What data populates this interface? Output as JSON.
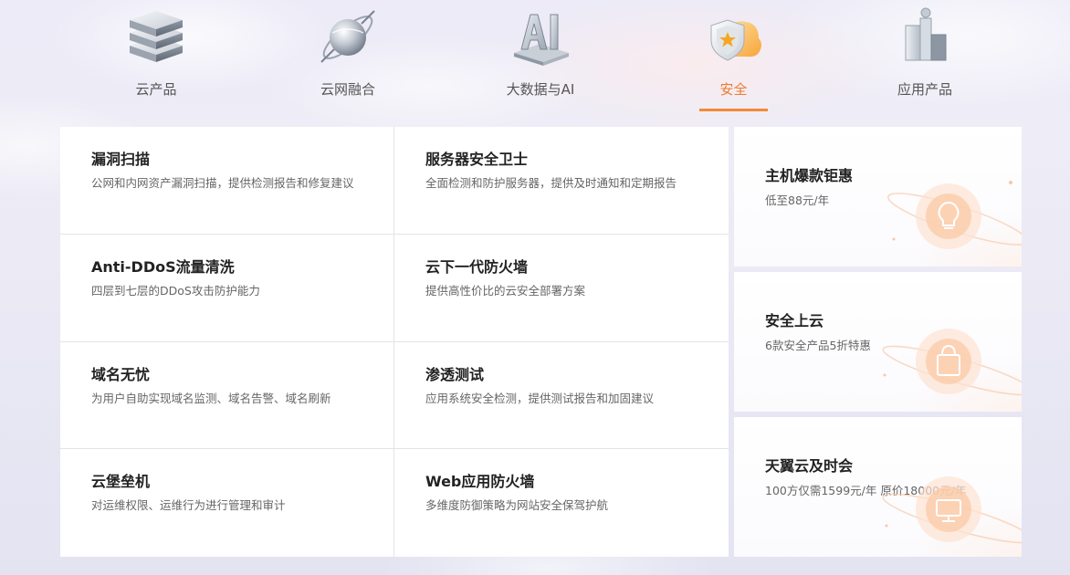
{
  "tabs": [
    {
      "label": "云产品",
      "icon": "server-stack-icon",
      "active": false
    },
    {
      "label": "云网融合",
      "icon": "globe-orbit-icon",
      "active": false
    },
    {
      "label": "大数据与AI",
      "icon": "ai-block-icon",
      "active": false
    },
    {
      "label": "安全",
      "icon": "shield-cloud-icon",
      "active": true
    },
    {
      "label": "应用产品",
      "icon": "app-blocks-icon",
      "active": false
    }
  ],
  "products": [
    {
      "title": "漏洞扫描",
      "desc": "公网和内网资产漏洞扫描，提供检测报告和修复建议"
    },
    {
      "title": "服务器安全卫士",
      "desc": "全面检测和防护服务器，提供及时通知和定期报告"
    },
    {
      "title": "Anti-DDoS流量清洗",
      "desc": "四层到七层的DDoS攻击防护能力"
    },
    {
      "title": "云下一代防火墙",
      "desc": "提供高性价比的云安全部署方案"
    },
    {
      "title": "域名无忧",
      "desc": "为用户自助实现域名监测、域名告警、域名刷新"
    },
    {
      "title": "渗透测试",
      "desc": "应用系统安全检测，提供测试报告和加固建议"
    },
    {
      "title": "云堡垒机",
      "desc": "对运维权限、运维行为进行管理和审计"
    },
    {
      "title": "Web应用防火墙",
      "desc": "多维度防御策略为网站安全保驾护航"
    }
  ],
  "promos": [
    {
      "title": "主机爆款钜惠",
      "desc": "低至88元/年",
      "icon": "lightbulb-icon"
    },
    {
      "title": "安全上云",
      "desc": "6款安全产品5折特惠",
      "icon": "shopping-bag-icon"
    },
    {
      "title": "天翼云及时会",
      "desc": "100方仅需1599元/年 原价18000元/年",
      "icon": "monitor-icon"
    }
  ],
  "colors": {
    "accent": "#ee7a2e",
    "underline": "#f28a35",
    "title": "#222222",
    "desc": "#666666"
  }
}
